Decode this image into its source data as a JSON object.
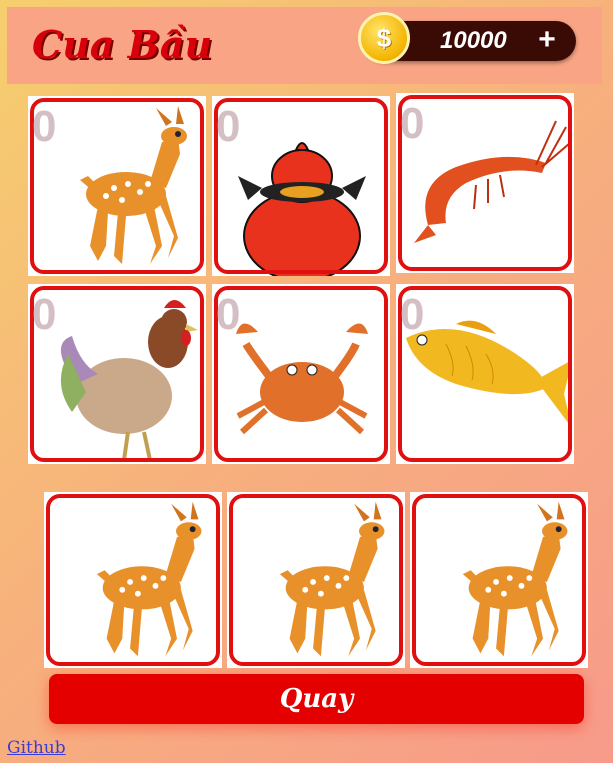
{
  "header": {
    "title": "Cua Bầu",
    "balance": "10000",
    "coin_symbol": "$",
    "add_symbol": "+"
  },
  "board": [
    {
      "animal": "deer",
      "count": "0"
    },
    {
      "animal": "gourd",
      "count": "0"
    },
    {
      "animal": "shrimp",
      "count": "0"
    },
    {
      "animal": "rooster",
      "count": "0"
    },
    {
      "animal": "crab",
      "count": "0"
    },
    {
      "animal": "fish",
      "count": "0"
    }
  ],
  "results": [
    "deer",
    "deer",
    "deer"
  ],
  "spin_label": "Quay",
  "footer_link": "Github",
  "colors": {
    "accent": "#e50000",
    "frame": "#e01010",
    "wallet": "#3a0a05"
  }
}
